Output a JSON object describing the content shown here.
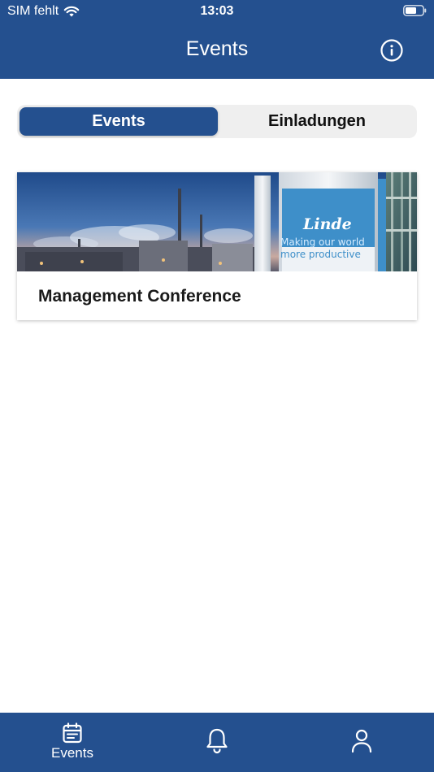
{
  "status_bar": {
    "carrier": "SIM fehlt",
    "time": "13:03"
  },
  "header": {
    "title": "Events",
    "info_icon": "info-circle-icon"
  },
  "segmented_control": {
    "options": [
      {
        "label": "Events",
        "selected": true
      },
      {
        "label": "Einladungen",
        "selected": false
      }
    ]
  },
  "events": [
    {
      "title": "Management Conference",
      "image_text": {
        "brand": "Linde",
        "slogan_line1": "Making our world",
        "slogan_line2": "more productive"
      }
    }
  ],
  "tab_bar": {
    "items": [
      {
        "label": "Events",
        "icon": "calendar-icon"
      },
      {
        "label": "",
        "icon": "bell-icon"
      },
      {
        "label": "",
        "icon": "person-icon"
      }
    ]
  },
  "colors": {
    "brand_blue": "#24508f",
    "segment_bg": "#efefef"
  }
}
